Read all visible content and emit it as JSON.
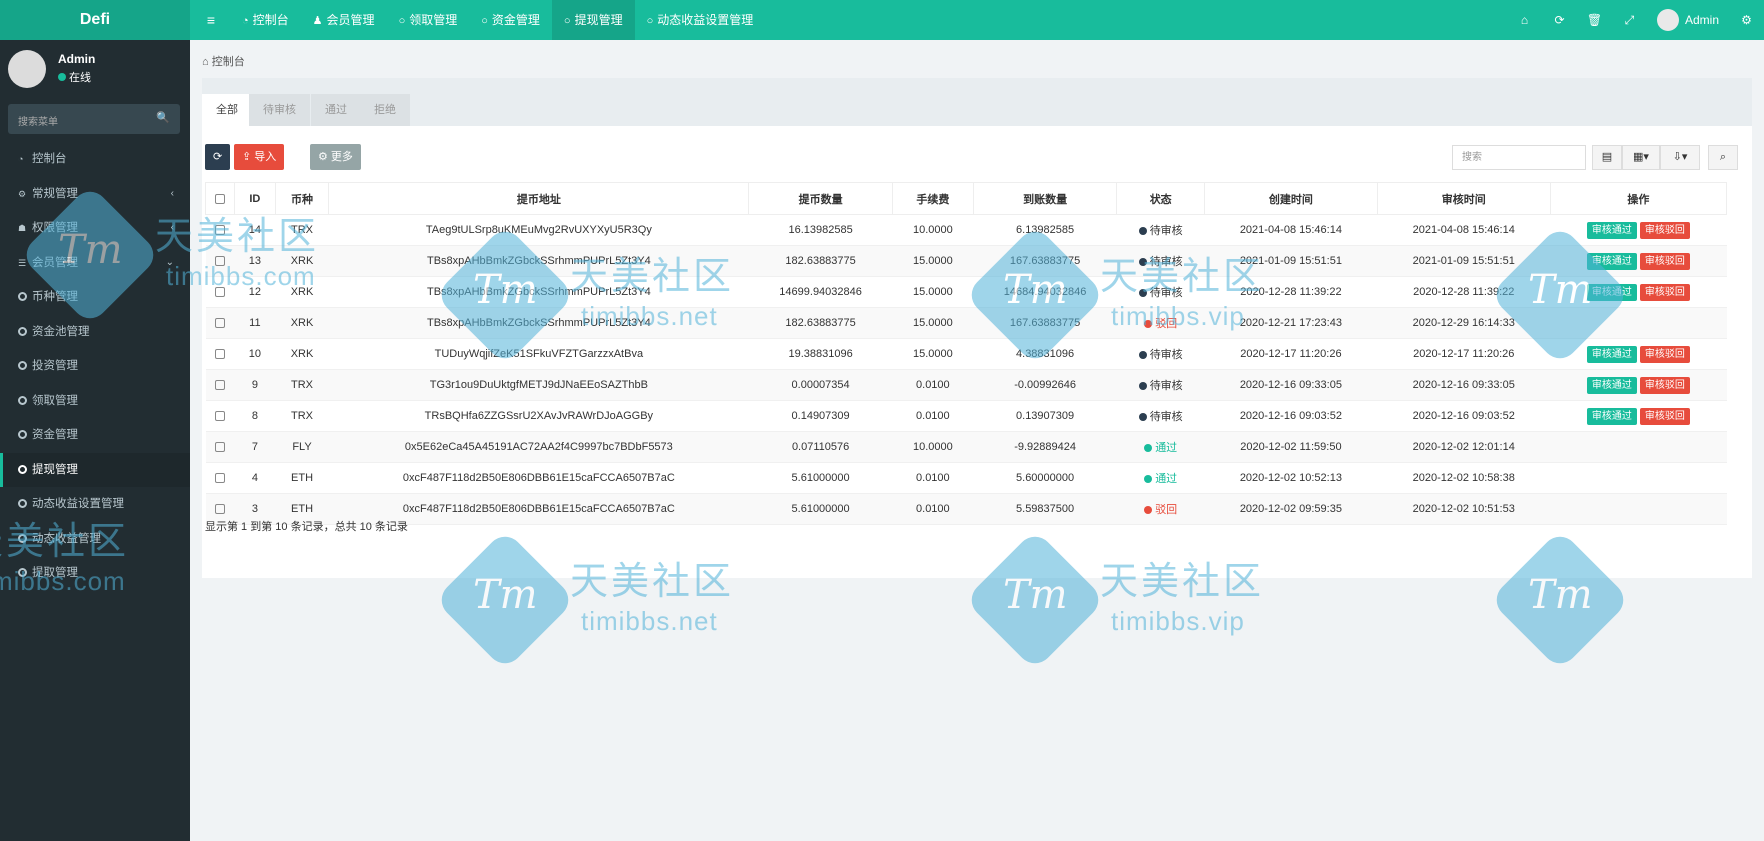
{
  "app": {
    "title": "Defi"
  },
  "nav": [
    {
      "label": "控制台",
      "icon": "dashboard-icon",
      "active": false
    },
    {
      "label": "会员管理",
      "icon": "user-icon",
      "active": false
    },
    {
      "label": "领取管理",
      "icon": "circle-icon",
      "active": false
    },
    {
      "label": "资金管理",
      "icon": "circle-icon",
      "active": false
    },
    {
      "label": "提现管理",
      "icon": "circle-icon",
      "active": true
    },
    {
      "label": "动态收益设置管理",
      "icon": "circle-icon",
      "active": false
    }
  ],
  "header_user": "Admin",
  "sidebar": {
    "user_name": "Admin",
    "status": "在线",
    "search_placeholder": "搜索菜单",
    "items": [
      {
        "label": "控制台",
        "type": "icon",
        "icon": "dashboard-icon"
      },
      {
        "label": "常规管理",
        "type": "icon",
        "icon": "cogs-icon",
        "chevron": "‹"
      },
      {
        "label": "权限管理",
        "type": "icon",
        "icon": "group-icon",
        "chevron": "‹"
      },
      {
        "label": "会员管理",
        "type": "icon",
        "icon": "list-icon",
        "chevron": "⌄"
      },
      {
        "label": "币种管理",
        "type": "circle"
      },
      {
        "label": "资金池管理",
        "type": "circle"
      },
      {
        "label": "投资管理",
        "type": "circle"
      },
      {
        "label": "领取管理",
        "type": "circle"
      },
      {
        "label": "资金管理",
        "type": "circle"
      },
      {
        "label": "提现管理",
        "type": "circle",
        "active": true
      },
      {
        "label": "动态收益设置管理",
        "type": "circle"
      },
      {
        "label": "动态收益管理",
        "type": "circle"
      },
      {
        "label": "提取管理",
        "type": "circle"
      }
    ]
  },
  "breadcrumb": "控制台",
  "tabs": [
    "全部",
    "待审核",
    "通过",
    "拒绝"
  ],
  "toolbar": {
    "refresh": "⟳",
    "import": "导入",
    "more": "更多",
    "search_placeholder": "搜索"
  },
  "table": {
    "headers": [
      "ID",
      "币种",
      "提币地址",
      "提币数量",
      "手续费",
      "到账数量",
      "状态",
      "创建时间",
      "审核时间",
      "操作"
    ],
    "rows": [
      {
        "id": "14",
        "coin": "TRX",
        "address": "TAeg9tULSrp8uKMEuMvg2RvUXYXyU5R3Qy",
        "amount": "16.13982585",
        "fee": "10.0000",
        "received": "6.13982585",
        "status": "待审核",
        "created": "2021-04-08 15:46:14",
        "reviewed": "2021-04-08 15:46:14",
        "actions": true
      },
      {
        "id": "13",
        "coin": "XRK",
        "address": "TBs8xpAHbBmkZGbckSSrhmmPUPrL5Zt3Y4",
        "amount": "182.63883775",
        "fee": "15.0000",
        "received": "167.63883775",
        "status": "待审核",
        "created": "2021-01-09 15:51:51",
        "reviewed": "2021-01-09 15:51:51",
        "actions": true
      },
      {
        "id": "12",
        "coin": "XRK",
        "address": "TBs8xpAHbBmkZGbckSSrhmmPUPrL5Zt3Y4",
        "amount": "14699.94032846",
        "fee": "15.0000",
        "received": "14684.94032846",
        "status": "待审核",
        "created": "2020-12-28 11:39:22",
        "reviewed": "2020-12-28 11:39:22",
        "actions": true
      },
      {
        "id": "11",
        "coin": "XRK",
        "address": "TBs8xpAHbBmkZGbckSSrhmmPUPrL5Zt3Y4",
        "amount": "182.63883775",
        "fee": "15.0000",
        "received": "167.63883775",
        "status": "驳回",
        "created": "2020-12-21 17:23:43",
        "reviewed": "2020-12-29 16:14:33",
        "actions": false
      },
      {
        "id": "10",
        "coin": "XRK",
        "address": "TUDuyWqjifZeK51SFkuVFZTGarzzxAtBva",
        "amount": "19.38831096",
        "fee": "15.0000",
        "received": "4.38831096",
        "status": "待审核",
        "created": "2020-12-17 11:20:26",
        "reviewed": "2020-12-17 11:20:26",
        "actions": true
      },
      {
        "id": "9",
        "coin": "TRX",
        "address": "TG3r1ou9DuUktgfMETJ9dJNaEEoSAZThbB",
        "amount": "0.00007354",
        "fee": "0.0100",
        "received": "-0.00992646",
        "status": "待审核",
        "created": "2020-12-16 09:33:05",
        "reviewed": "2020-12-16 09:33:05",
        "actions": true
      },
      {
        "id": "8",
        "coin": "TRX",
        "address": "TRsBQHfa6ZZGSsrU2XAvJvRAWrDJoAGGBy",
        "amount": "0.14907309",
        "fee": "0.0100",
        "received": "0.13907309",
        "status": "待审核",
        "created": "2020-12-16 09:03:52",
        "reviewed": "2020-12-16 09:03:52",
        "actions": true
      },
      {
        "id": "7",
        "coin": "FLY",
        "address": "0x5E62eCa45A45191AC72AA2f4C9997bc7BDbF5573",
        "amount": "0.07110576",
        "fee": "10.0000",
        "received": "-9.92889424",
        "status": "通过",
        "created": "2020-12-02 11:59:50",
        "reviewed": "2020-12-02 12:01:14",
        "actions": false
      },
      {
        "id": "4",
        "coin": "ETH",
        "address": "0xcF487F118d2B50E806DBB61E15caFCCA6507B7aC",
        "amount": "5.61000000",
        "fee": "0.0100",
        "received": "5.60000000",
        "status": "通过",
        "created": "2020-12-02 10:52:13",
        "reviewed": "2020-12-02 10:58:38",
        "actions": false
      },
      {
        "id": "3",
        "coin": "ETH",
        "address": "0xcF487F118d2B50E806DBB61E15caFCCA6507B7aC",
        "amount": "5.61000000",
        "fee": "0.0100",
        "received": "5.59837500",
        "status": "驳回",
        "created": "2020-12-02 09:59:35",
        "reviewed": "2020-12-02 10:51:53",
        "actions": false
      }
    ],
    "approve_label": "审核通过",
    "reject_label": "审核驳回"
  },
  "status_colors": {
    "待审核": "#2c3e50",
    "通过": "#18bc9c",
    "驳回": "#e74c3c"
  },
  "summary": "显示第 1 到第 10 条记录，总共 10 条记录",
  "watermark": {
    "cn": "天美社区",
    "en_net": "timibbs.net",
    "en_com": "timibbs.com",
    "en_vip": "timibbs.vip",
    "logo": "Tm"
  }
}
